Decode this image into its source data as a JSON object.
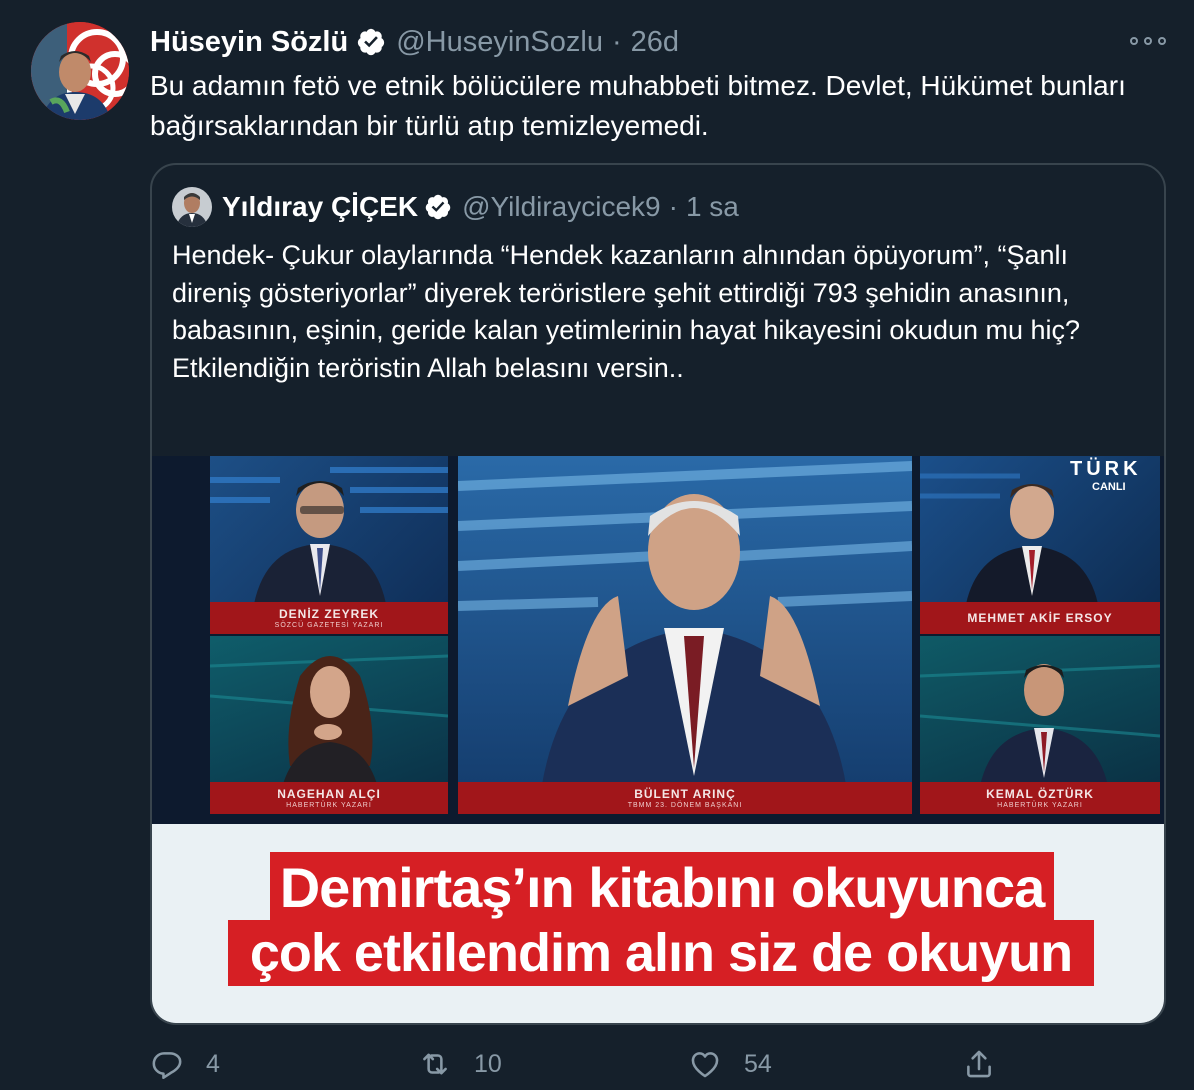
{
  "tweet": {
    "author_name": "Hüseyin Sözlü",
    "author_handle": "@HuseyinSozlu",
    "separator": "·",
    "time": "26d",
    "text": "Bu adamın fetö ve etnik bölücülere muhabbeti bitmez. Devlet, Hükümet bunları bağırsaklarından  bir türlü atıp temizleyemedi."
  },
  "quote": {
    "author_name": "Yıldıray ÇİÇEK",
    "author_handle": "@Yildiraycicek9",
    "separator": "·",
    "time": "1 sa",
    "text": "Hendek- Çukur olaylarında “Hendek kazanların alnından öpüyorum”, “Şanlı direniş gösteriyorlar” diyerek teröristlere şehit ettirdiği 793 şehidin anasının, babasının, eşinin, geride kalan yetimlerinin hayat hikayesini okudun mu hiç?\nEtkilendiğin teröristin Allah belasını versin.."
  },
  "media": {
    "channel_logo": "TÜRK",
    "live_badge": "CANLI",
    "panelists": [
      {
        "name": "DENİZ ZEYREK",
        "title": "SÖZCÜ GAZETESİ YAZARI"
      },
      {
        "name": "NAGEHAN ALÇI",
        "title": "HABERTÜRK YAZARI"
      },
      {
        "name": "BÜLENT ARINÇ",
        "title": "TBMM 23. DÖNEM BAŞKANI"
      },
      {
        "name": "MEHMET AKİF ERSOY",
        "title": ""
      },
      {
        "name": "KEMAL ÖZTÜRK",
        "title": "HABERTÜRK YAZARI"
      }
    ],
    "headline_line1": "Demirtaş’ın kitabını okuyunca",
    "headline_line2": "çok etkilendim alın siz de okuyun"
  },
  "actions": {
    "reply_count": "4",
    "retweet_count": "10",
    "like_count": "54"
  },
  "colors": {
    "background": "#15202b",
    "secondary_text": "#8899a6",
    "border": "#38444d",
    "verified": "#ffffff",
    "headline_red": "#d61f24"
  },
  "icons": [
    "verified-icon",
    "more-icon",
    "reply-icon",
    "retweet-icon",
    "like-icon",
    "share-icon"
  ]
}
